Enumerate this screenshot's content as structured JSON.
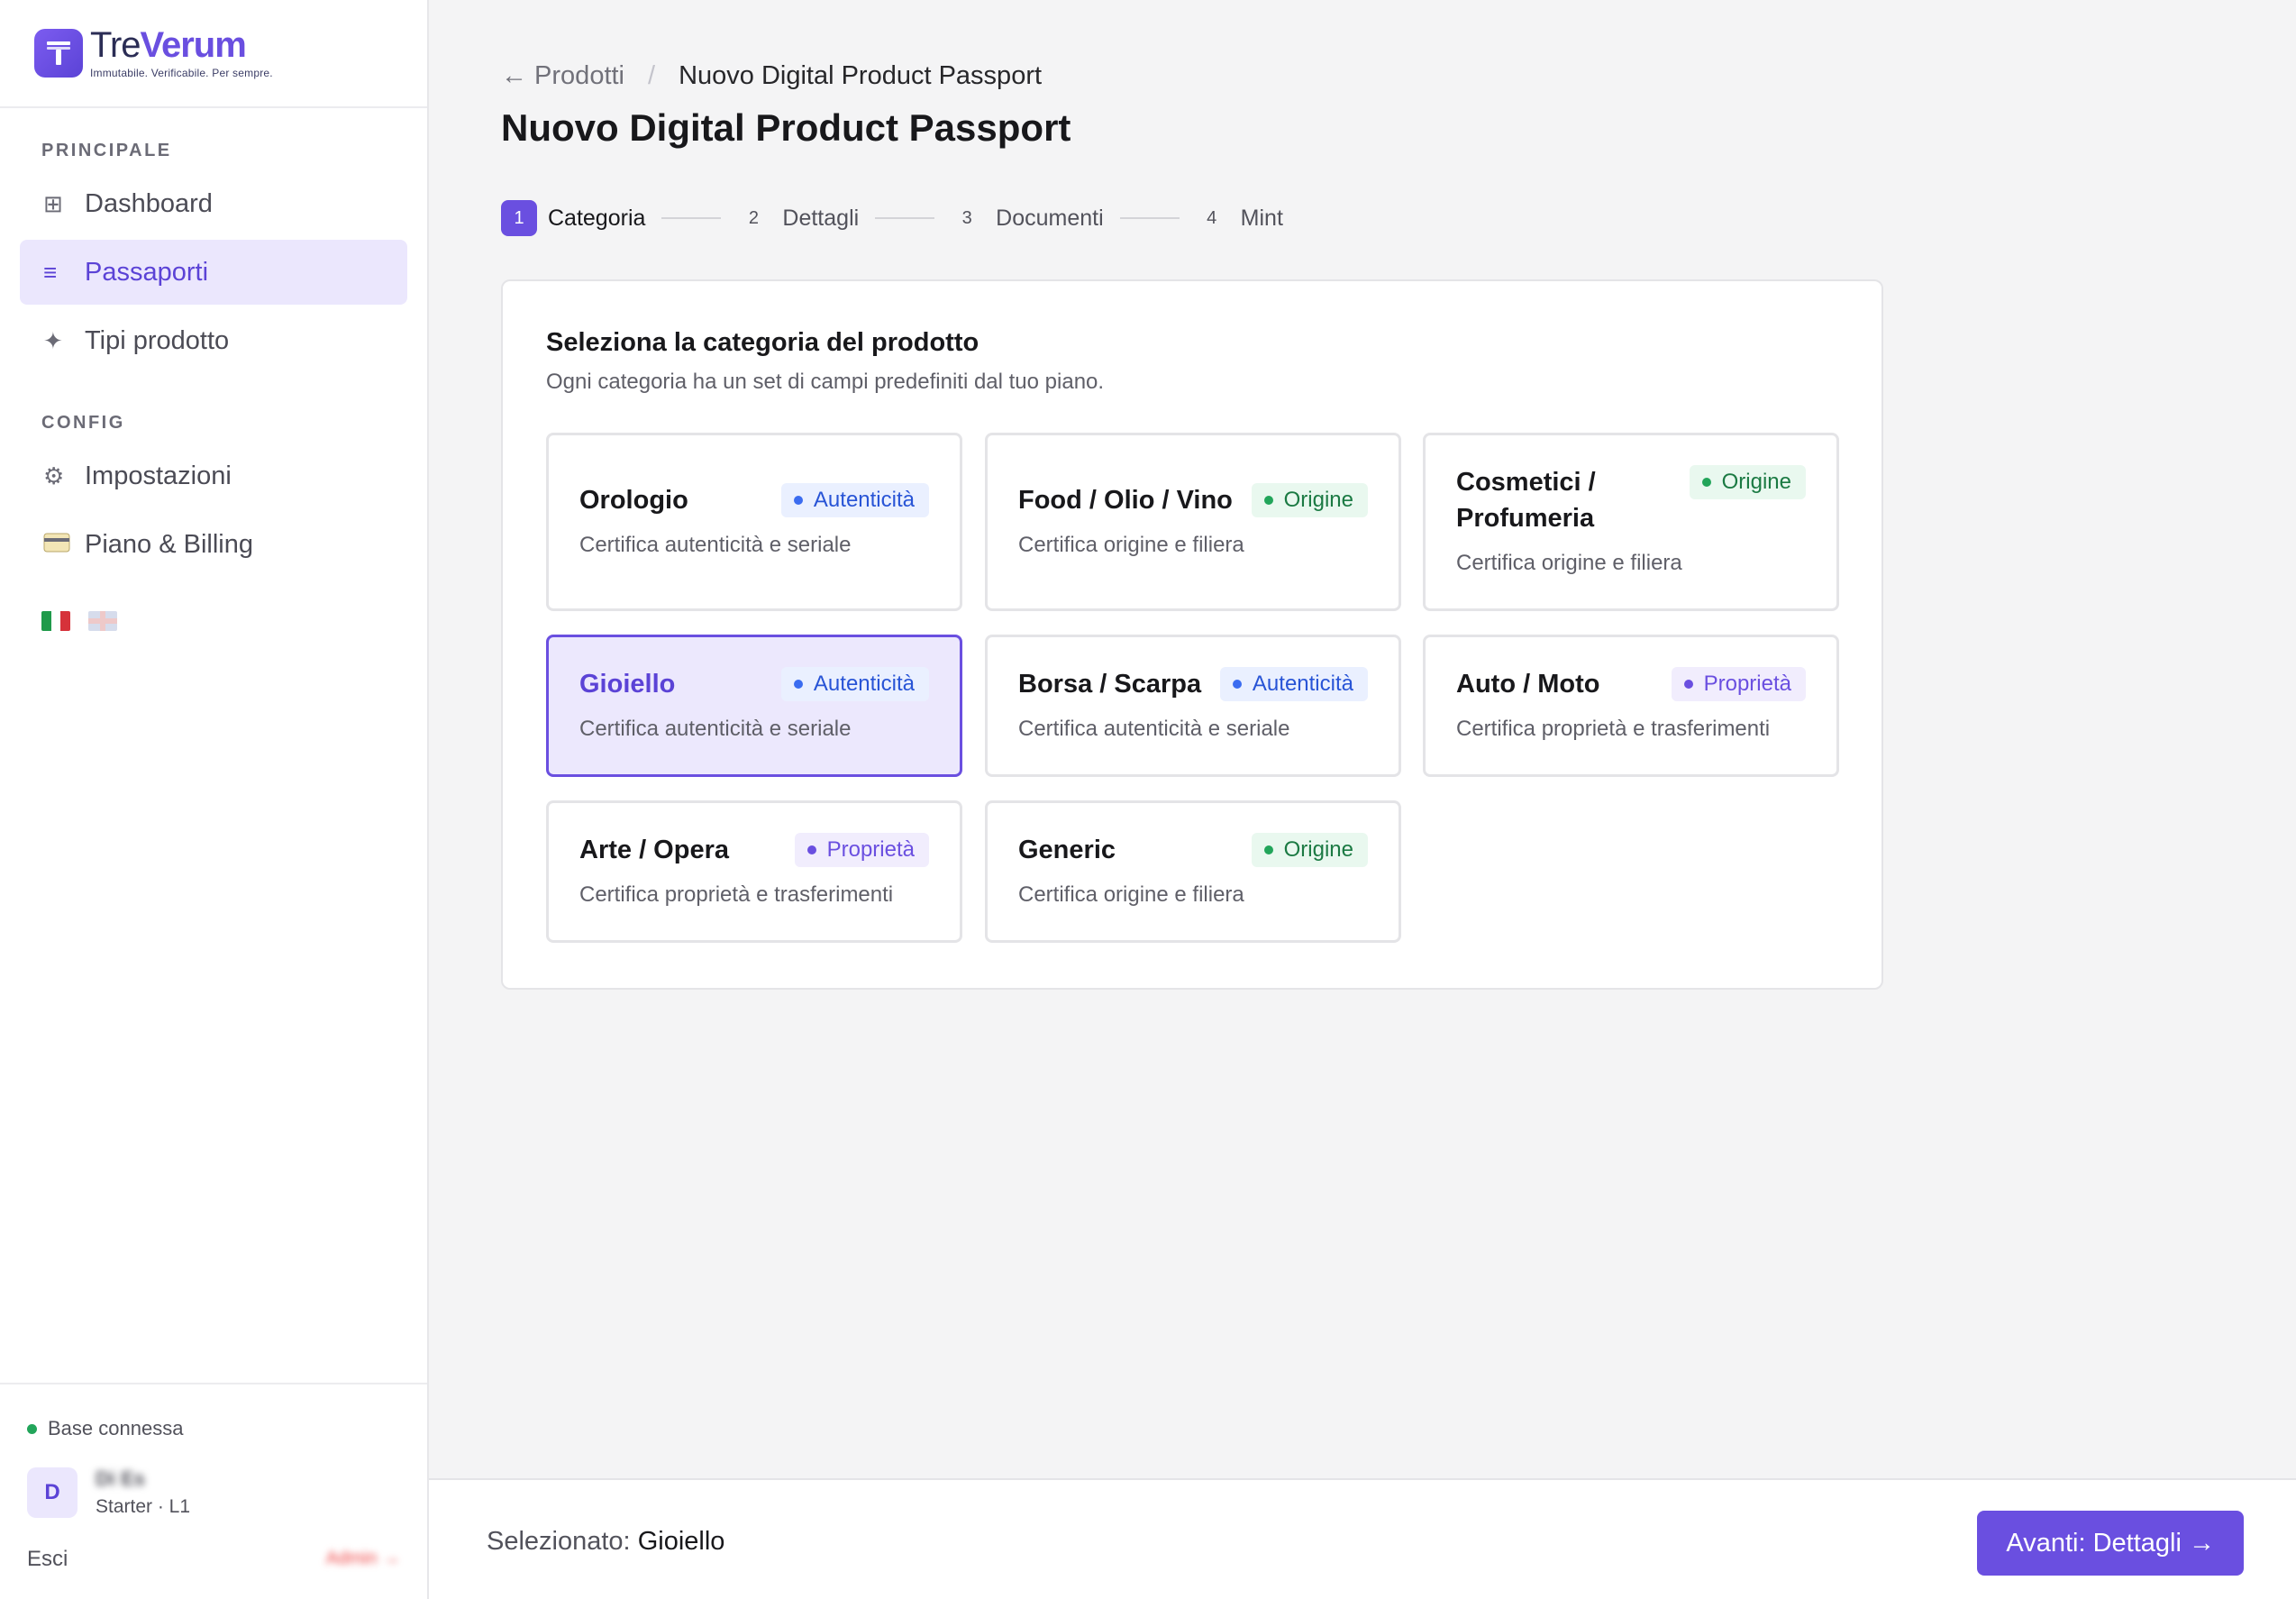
{
  "brand": {
    "name_part1": "Tre",
    "name_part2": "Verum",
    "tagline": "Immutabile. Verificabile. Per sempre."
  },
  "sidebar": {
    "section_main": "PRINCIPALE",
    "section_config": "CONFIG",
    "items": [
      {
        "label": "Dashboard",
        "icon": "grid-icon",
        "glyph": "⊞"
      },
      {
        "label": "Passaporti",
        "icon": "list-icon",
        "glyph": "≡",
        "active": true
      },
      {
        "label": "Tipi prodotto",
        "icon": "sparkle-icon",
        "glyph": "✦"
      },
      {
        "label": "Impostazioni",
        "icon": "gear-icon",
        "glyph": "⚙"
      },
      {
        "label": "Piano & Billing",
        "icon": "credit-card-icon",
        "glyph": "💳"
      }
    ],
    "languages": [
      "it",
      "en"
    ],
    "status": "Base connessa",
    "user": {
      "initial": "D",
      "name": "Di Es",
      "plan": "Starter · L1"
    },
    "logout": "Esci",
    "admin": "Admin →"
  },
  "breadcrumb": {
    "back": "← Prodotti",
    "separator": "/",
    "current": "Nuovo Digital Product Passport"
  },
  "page_title": "Nuovo Digital Product Passport",
  "stepper": [
    {
      "num": "1",
      "label": "Categoria",
      "active": true
    },
    {
      "num": "2",
      "label": "Dettagli"
    },
    {
      "num": "3",
      "label": "Documenti"
    },
    {
      "num": "4",
      "label": "Mint"
    }
  ],
  "card": {
    "title": "Seleziona la categoria del prodotto",
    "subtitle": "Ogni categoria ha un set di campi predefiniti dal tuo piano."
  },
  "categories": [
    {
      "name": "Orologio",
      "badge": "Autenticità",
      "badge_type": "auth",
      "desc": "Certifica autenticità e seriale"
    },
    {
      "name": "Food / Olio / Vino",
      "badge": "Origine",
      "badge_type": "orig",
      "desc": "Certifica origine e filiera"
    },
    {
      "name_line1": "Cosmetici /",
      "name_line2": "Profumeria",
      "badge": "Origine",
      "badge_type": "orig",
      "desc": "Certifica origine e filiera"
    },
    {
      "name": "Gioiello",
      "badge": "Autenticità",
      "badge_type": "auth",
      "desc": "Certifica autenticità e seriale",
      "selected": true
    },
    {
      "name": "Borsa / Scarpa",
      "badge": "Autenticità",
      "badge_type": "auth",
      "desc": "Certifica autenticità e seriale"
    },
    {
      "name": "Auto / Moto",
      "badge": "Proprietà",
      "badge_type": "prop",
      "desc": "Certifica proprietà e trasferimenti"
    },
    {
      "name": "Arte / Opera",
      "badge": "Proprietà",
      "badge_type": "prop",
      "desc": "Certifica proprietà e trasferimenti"
    },
    {
      "name": "Generic",
      "badge": "Origine",
      "badge_type": "orig",
      "desc": "Certifica origine e filiera"
    }
  ],
  "footer": {
    "selected_label": "Selezionato:",
    "selected_value": "Gioiello",
    "next_button": "Avanti: Dettagli →"
  },
  "colors": {
    "accent": "#6a4fe0",
    "auth": "#2854d6",
    "origin": "#1b7a43",
    "property": "#6a4fe0",
    "status_ok": "#22a55a",
    "admin": "#ef4444"
  }
}
